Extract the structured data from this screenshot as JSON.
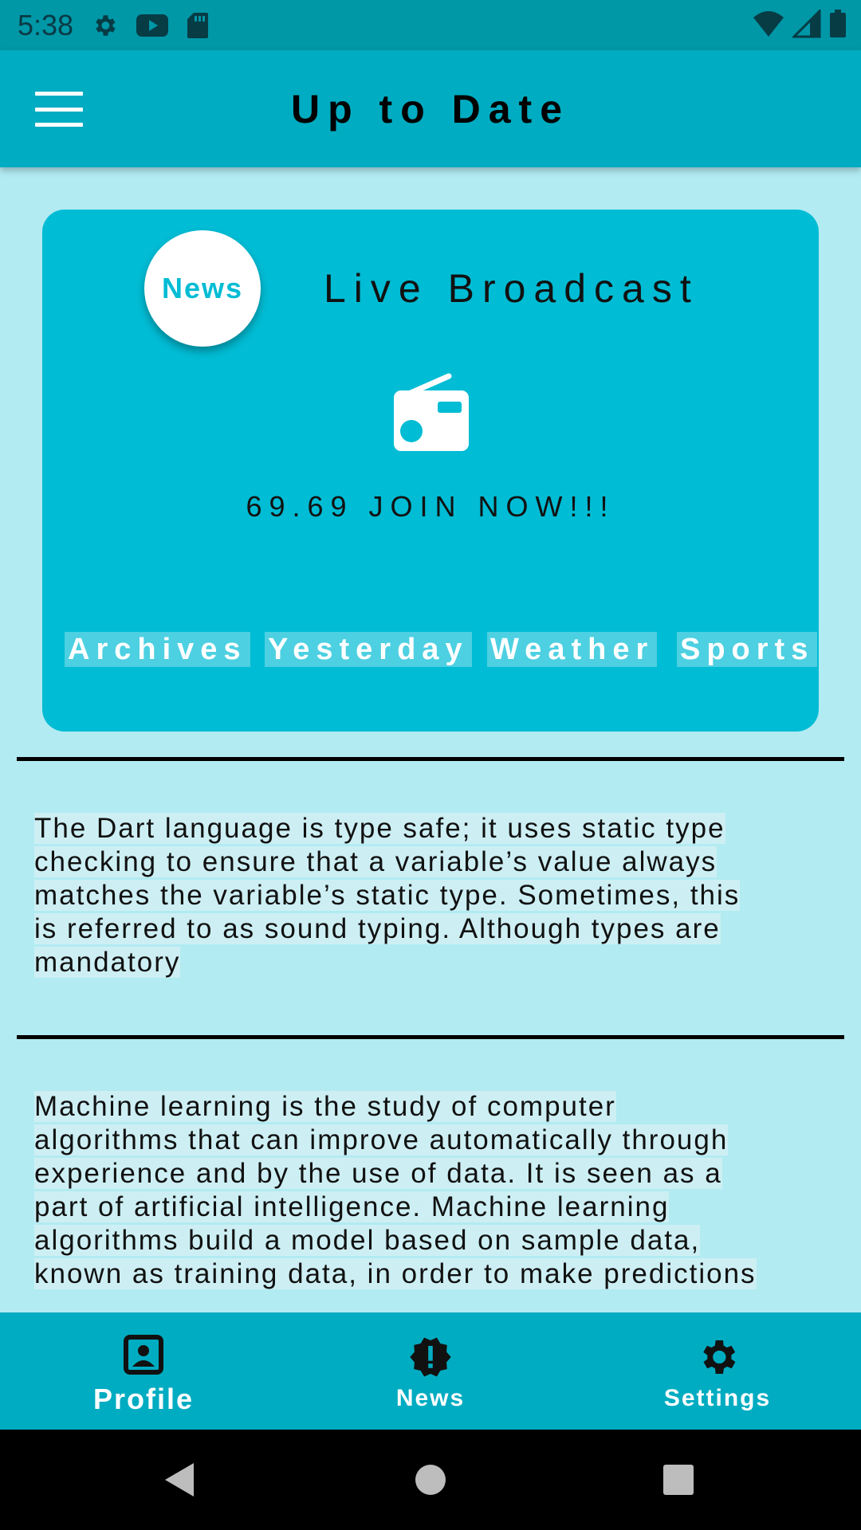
{
  "status_bar": {
    "time": "5:38",
    "icons_left": [
      "gear-icon",
      "youtube-icon",
      "sd-card-icon"
    ],
    "icons_right": [
      "wifi-icon",
      "signal-icon",
      "battery-icon"
    ]
  },
  "app_bar": {
    "title": "Up to Date",
    "menu_icon": "menu-icon"
  },
  "card": {
    "badge_label": "News",
    "title": "Live Broadcast",
    "icon": "radio-icon",
    "subtitle": "69.69 JOIN NOW!!!",
    "chips": [
      "Archives",
      "Yesterday",
      "Weather",
      "Sports"
    ]
  },
  "articles": [
    {
      "lines": [
        "The Dart language is type safe; it uses static type",
        "checking to ensure that a variable’s value always",
        "matches the variable’s static type. Sometimes, this",
        "is referred to as sound typing. Although types are",
        "mandatory"
      ]
    },
    {
      "lines": [
        "Machine learning is the study of computer",
        "algorithms that can improve automatically through",
        "experience and by the use of data. It is seen as a",
        "part of artificial intelligence. Machine learning",
        "algorithms build a model based on sample data,",
        "known as training data, in order to make predictions"
      ]
    }
  ],
  "bottom_nav": {
    "items": [
      {
        "label": "Profile",
        "icon": "profile-icon"
      },
      {
        "label": "News",
        "icon": "alert-badge-icon"
      },
      {
        "label": "Settings",
        "icon": "settings-icon"
      }
    ]
  },
  "system_nav": {
    "icons": [
      "back-icon",
      "home-icon",
      "recents-icon"
    ]
  },
  "colors": {
    "background": "#b2ebf2",
    "app_bar": "#00acc1",
    "card": "#00bcd4",
    "status_bar": "#0097a7"
  }
}
